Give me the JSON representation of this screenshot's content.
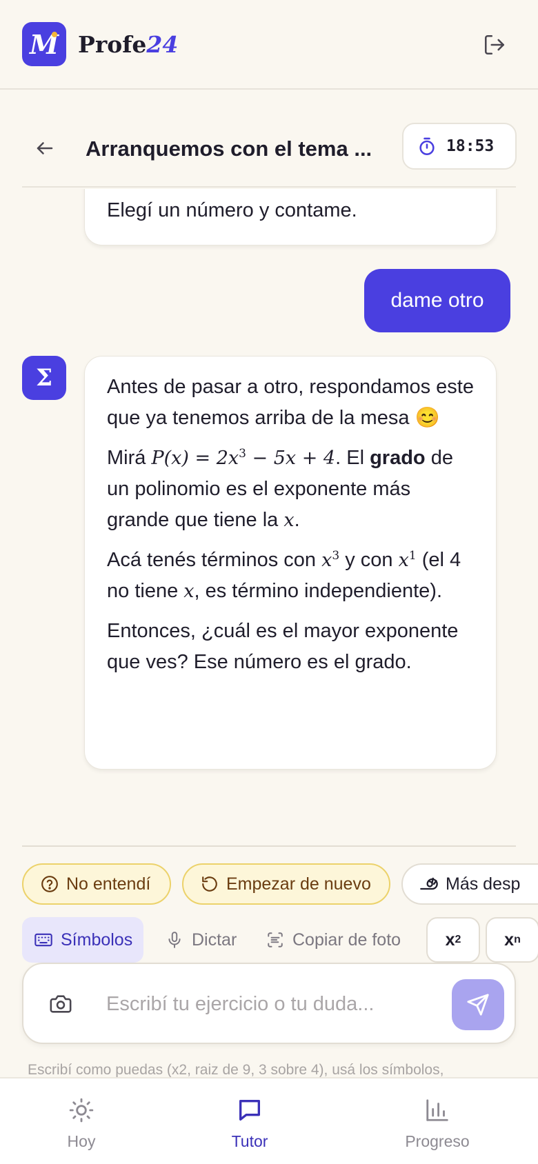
{
  "app": {
    "brand_main": "Profe",
    "brand_accent": "24",
    "logo_letter": "M",
    "logout_icon": "logout-icon",
    "accent_color": "#4a3fe0"
  },
  "chat_header": {
    "title": "Arranquemos con el tema ...",
    "timer": "18:53",
    "back_icon": "arrow-left-icon",
    "timer_icon": "stopwatch-icon"
  },
  "messages": {
    "prev_tutor_text": "Elegí un número y contame.",
    "user_text": "dame otro",
    "avatar_symbol": "Σ",
    "tutor": {
      "p1": "Antes de pasar a otro, respondamos este que ya tenemos arriba de la mesa 😊",
      "p2_a": "Mirá ",
      "p2_math": "P(x) = 2x",
      "p2_sup": "3",
      "p2_math_b": " − 5x + 4",
      "p2_b": ". El ",
      "p2_bold": "grado",
      "p2_c": " de un polinomio es el exponente más grande que tiene la ",
      "p2_x": "x",
      "p2_d": ".",
      "p3_a": "Acá tenés términos con ",
      "p3_x1": "x",
      "p3_sup1": "3",
      "p3_b": " y con ",
      "p3_x2": "x",
      "p3_sup2": "1",
      "p3_c": " (el 4 no tiene ",
      "p3_x3": "x",
      "p3_d": ", es término independiente).",
      "p4": "Entonces, ¿cuál es el mayor exponente que ves? Ese número es el grado."
    }
  },
  "chips": [
    {
      "label": "No entendí",
      "icon": "question-circle-icon"
    },
    {
      "label": "Empezar de nuevo",
      "icon": "restart-icon"
    },
    {
      "label": "Más desp",
      "icon": "snail-icon"
    }
  ],
  "tools": {
    "symbols": "Símbolos",
    "dictate": "Dictar",
    "copy_photo": "Copiar de foto",
    "key_x2_base": "x",
    "key_x2_sup": "2",
    "key_xn_base": "x",
    "key_xn_sup": "n"
  },
  "composer": {
    "placeholder": "Escribí tu ejercicio o tu duda...",
    "value": ""
  },
  "hint": "Escribí como puedas (x2, raiz de 9, 3 sobre 4), usá los símbolos,",
  "nav": [
    {
      "label": "Hoy",
      "icon": "sun-icon"
    },
    {
      "label": "Tutor",
      "icon": "chat-icon"
    },
    {
      "label": "Progreso",
      "icon": "bar-chart-icon"
    }
  ]
}
